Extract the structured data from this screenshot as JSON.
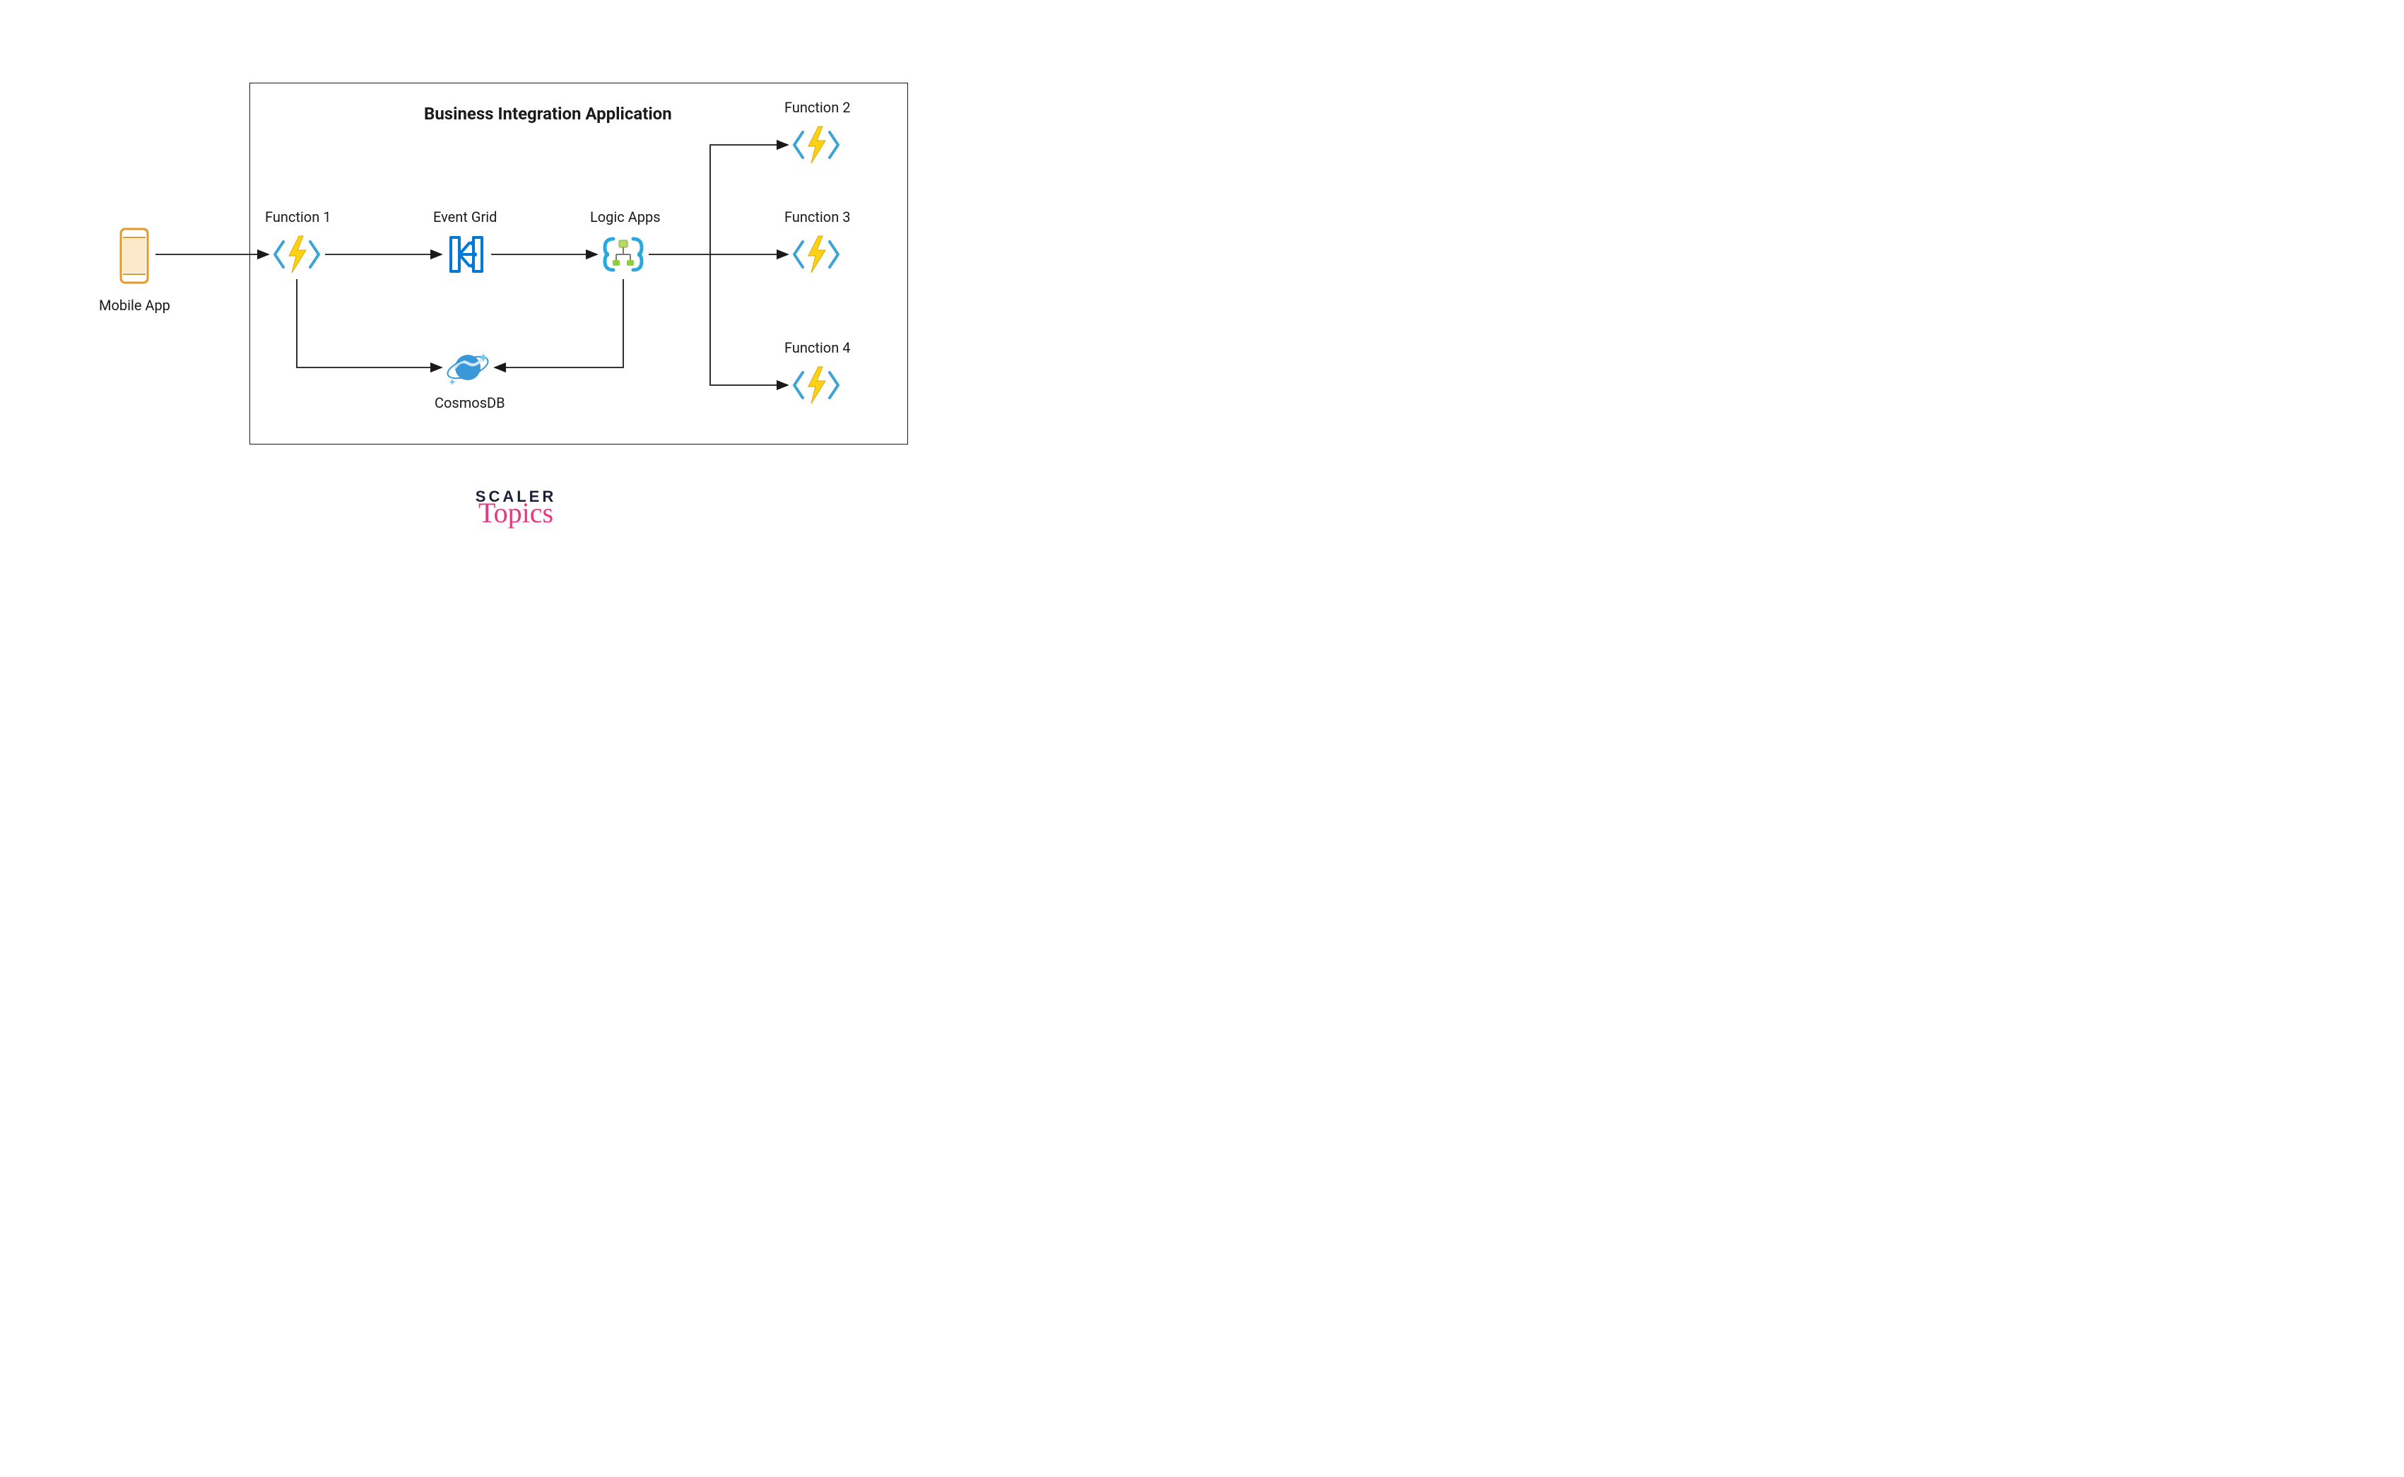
{
  "title": "Business Integration Application",
  "nodes": {
    "mobile_app": "Mobile App",
    "function1": "Function 1",
    "event_grid": "Event Grid",
    "logic_apps": "Logic Apps",
    "cosmosdb": "CosmosDB",
    "function2": "Function 2",
    "function3": "Function 3",
    "function4": "Function 4"
  },
  "logo": {
    "line1": "SCALER",
    "line2": "Topics"
  },
  "edges": [
    {
      "from": "mobile_app",
      "to": "function1"
    },
    {
      "from": "function1",
      "to": "event_grid"
    },
    {
      "from": "event_grid",
      "to": "logic_apps"
    },
    {
      "from": "function1",
      "to": "cosmosdb"
    },
    {
      "from": "logic_apps",
      "to": "cosmosdb"
    },
    {
      "from": "logic_apps",
      "to": "function2"
    },
    {
      "from": "logic_apps",
      "to": "function3"
    },
    {
      "from": "logic_apps",
      "to": "function4"
    }
  ]
}
